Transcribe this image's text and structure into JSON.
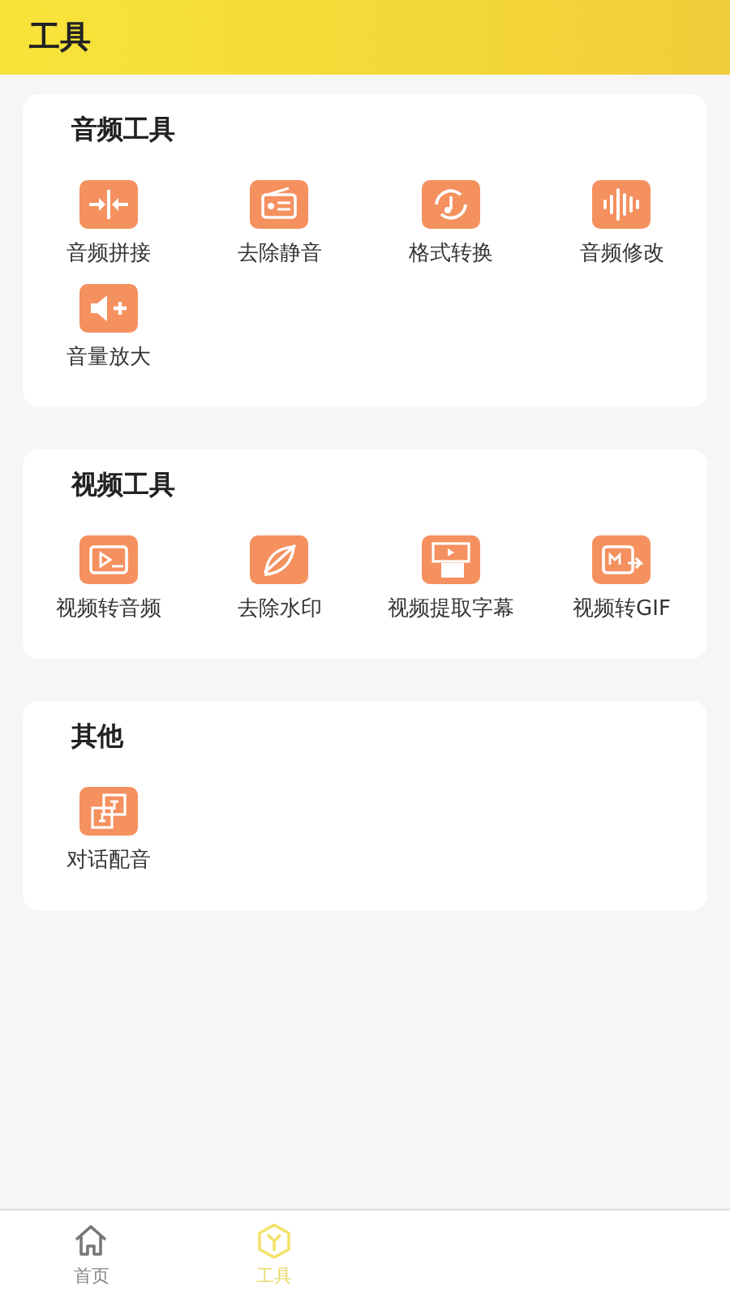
{
  "header": {
    "title": "工具"
  },
  "sections": [
    {
      "title": "音频工具",
      "items": [
        {
          "label": "音频拼接"
        },
        {
          "label": "去除静音"
        },
        {
          "label": "格式转换"
        },
        {
          "label": "音频修改"
        },
        {
          "label": "音量放大"
        }
      ]
    },
    {
      "title": "视频工具",
      "items": [
        {
          "label": "视频转音频"
        },
        {
          "label": "去除水印"
        },
        {
          "label": "视频提取字幕"
        },
        {
          "label": "视频转GIF"
        }
      ]
    },
    {
      "title": "其他",
      "items": [
        {
          "label": "对话配音"
        }
      ]
    }
  ],
  "tabs": [
    {
      "label": "首页",
      "selected": false
    },
    {
      "label": "工具",
      "selected": true
    }
  ]
}
